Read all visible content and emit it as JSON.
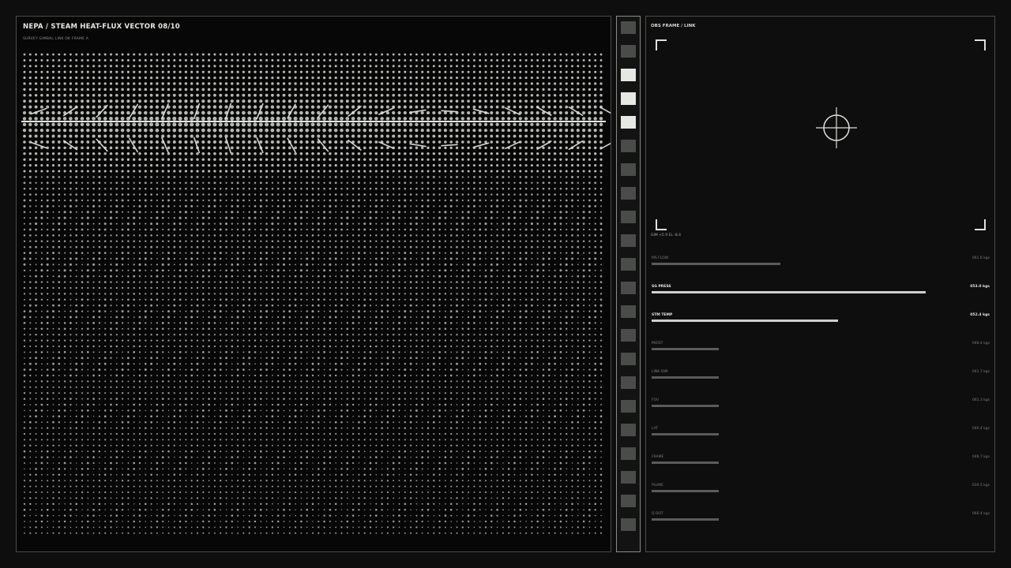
{
  "left_panel": {
    "title": "NEPA / STEAM HEAT-FLUX VECTOR 08/10",
    "subtitle": "SURVEY GIMBAL LINK OK FRAME A"
  },
  "strip": {
    "cells": [
      false,
      false,
      true,
      true,
      true,
      false,
      false,
      false,
      false,
      false,
      false,
      false,
      false,
      false,
      false,
      false,
      false,
      false,
      false,
      false,
      false,
      false
    ]
  },
  "right_panel": {
    "title": "OBS FRAME / LINK",
    "gim_readout": "GIM +5.9 EL -8.4",
    "metrics": [
      {
        "label": "MS FLOW",
        "value": "061.6 kgs",
        "level": 0.47,
        "highlight": false
      },
      {
        "label": "SG PRESS",
        "value": "053.0 kgs",
        "level": 1.0,
        "highlight": true
      },
      {
        "label": "STM TEMP",
        "value": "052.4 kgs",
        "level": 0.68,
        "highlight": true
      },
      {
        "label": "MOIST",
        "value": "048.4 kgs",
        "level": 0.245,
        "highlight": false
      },
      {
        "label": "LINK SNR",
        "value": "041.7 kgs",
        "level": 0.245,
        "highlight": false
      },
      {
        "label": "FOV",
        "value": "061.3 kgs",
        "level": 0.245,
        "highlight": false
      },
      {
        "label": "LAT",
        "value": "046.4 kgs",
        "level": 0.245,
        "highlight": false
      },
      {
        "label": "FRAME",
        "value": "048.7 kgs",
        "level": 0.245,
        "highlight": false
      },
      {
        "label": "PLUME",
        "value": "039.5 kgs",
        "level": 0.245,
        "highlight": false
      },
      {
        "label": "Q DOT",
        "value": "066.4 kgs",
        "level": 0.245,
        "highlight": false
      }
    ]
  },
  "colors": {
    "background": "#0d0e0d",
    "dot": "#d6d7d2",
    "accent": "#e6e8e4",
    "dim": "#4a4c4a"
  }
}
